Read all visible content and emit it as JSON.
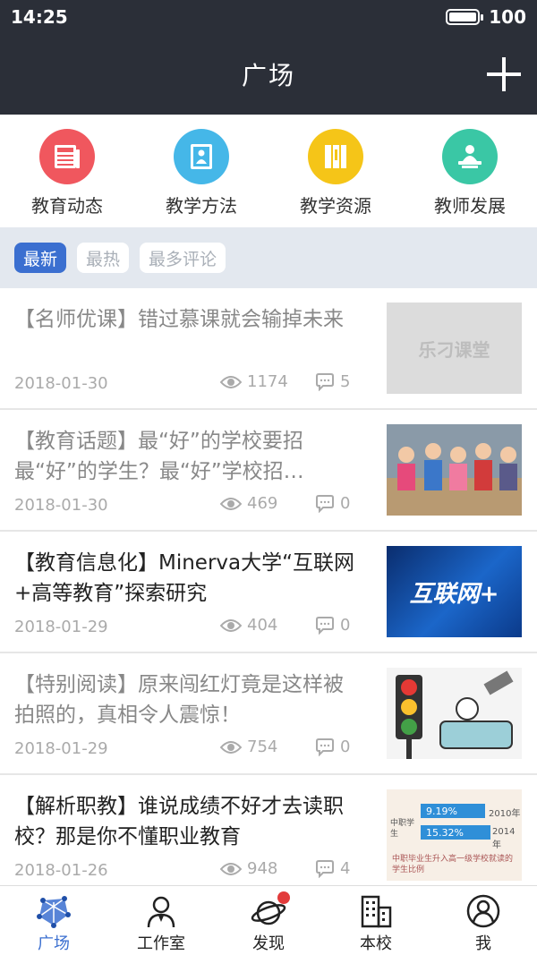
{
  "status": {
    "time": "14:25",
    "battery": "100"
  },
  "header": {
    "title": "广场"
  },
  "categories": [
    {
      "label": "教育动态",
      "color": "#f0575e",
      "icon": "news-icon"
    },
    {
      "label": "教学方法",
      "color": "#45b7e8",
      "icon": "whiteboard-icon"
    },
    {
      "label": "教学资源",
      "color": "#f5c518",
      "icon": "books-icon"
    },
    {
      "label": "教师发展",
      "color": "#3ac7a5",
      "icon": "teacher-podium-icon"
    }
  ],
  "filters": [
    "最新",
    "最热",
    "最多评论"
  ],
  "articles": [
    {
      "title": "【名师优课】错过慕课就会输掉未来",
      "date": "2018-01-30",
      "views": "1174",
      "comments": "5",
      "thumb_text": "乐刁课堂"
    },
    {
      "title": "【教育话题】最“好”的学校要招最“好”的学生？最“好”学校招最“好”的学生？",
      "date": "2018-01-30",
      "views": "469",
      "comments": "0"
    },
    {
      "title": "【教育信息化】Minerva大学“互联网+高等教育”探索研究",
      "date": "2018-01-29",
      "views": "404",
      "comments": "0",
      "thumb_text": "互联网+"
    },
    {
      "title": "【特别阅读】原来闯红灯竟是这样被拍照的，真相令人震惊！",
      "date": "2018-01-29",
      "views": "754",
      "comments": "0"
    },
    {
      "title": "【解析职教】谁说成绩不好才去读职校？那是你不懂职业教育",
      "date": "2018-01-26",
      "views": "948",
      "comments": "4",
      "thumb_a": "9.19%",
      "thumb_a_year": "2010年",
      "thumb_b": "15.32%",
      "thumb_b_year": "2014年",
      "thumb_side": "中职学生",
      "thumb_caption": "中职毕业生升入高一级学校就读的学生比例"
    }
  ],
  "nav": [
    {
      "label": "广场",
      "icon": "plaza-icon",
      "active": true
    },
    {
      "label": "工作室",
      "icon": "studio-person-icon"
    },
    {
      "label": "发现",
      "icon": "planet-icon",
      "badge": true
    },
    {
      "label": "本校",
      "icon": "building-icon"
    },
    {
      "label": "我",
      "icon": "profile-icon"
    }
  ],
  "colors": {
    "header": "#2b2f38",
    "accent": "#3b6fd0",
    "filterbar": "#e3e8ef"
  }
}
